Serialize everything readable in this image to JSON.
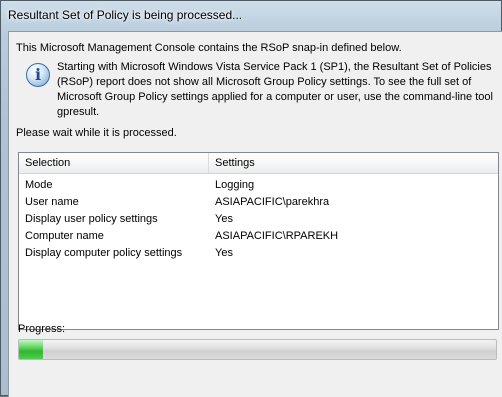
{
  "window": {
    "title": "Resultant Set of Policy is being processed..."
  },
  "intro_text": "This Microsoft Management Console contains the RSoP snap-in defined below.",
  "notice": {
    "icon": "info-icon",
    "text": "Starting with Microsoft Windows Vista Service Pack 1 (SP1), the Resultant Set of Policies (RSoP) report does not show all Microsoft Group Policy settings.  To see the full set of Microsoft Group Policy settings applied for a computer or user, use the command-line tool gpresult."
  },
  "wait_text": "Please wait while it is processed.",
  "list": {
    "columns": [
      "Selection",
      "Settings"
    ],
    "rows": [
      {
        "selection": "Mode",
        "settings": "Logging"
      },
      {
        "selection": "User name",
        "settings": "ASIAPACIFIC\\parekhra"
      },
      {
        "selection": "Display user policy settings",
        "settings": "Yes"
      },
      {
        "selection": "Computer name",
        "settings": "ASIAPACIFIC\\RPAREKH"
      },
      {
        "selection": "Display computer policy settings",
        "settings": "Yes"
      }
    ]
  },
  "progress": {
    "label": "Progress:",
    "fraction": 0.05,
    "color": "#3cc23c"
  }
}
